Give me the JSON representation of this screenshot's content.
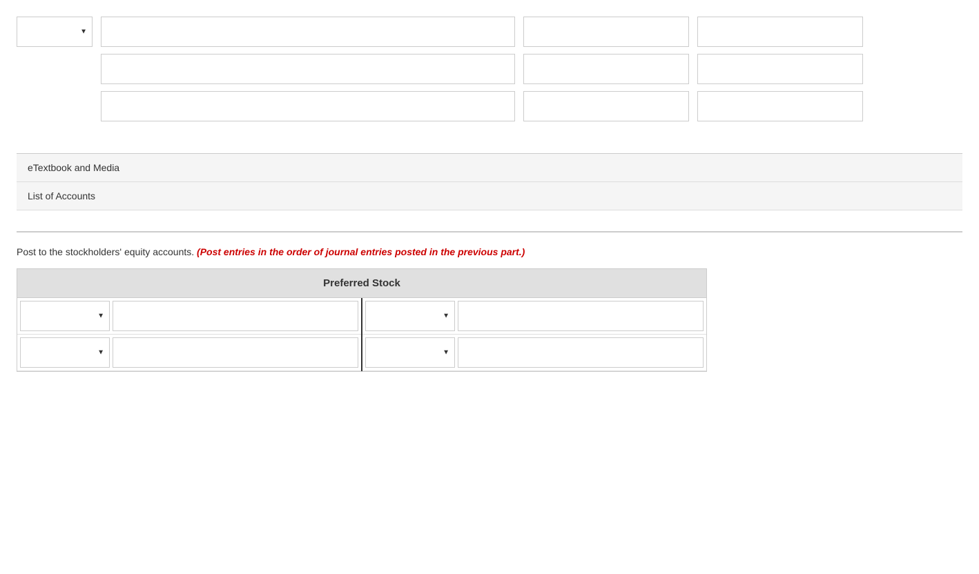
{
  "top_form": {
    "rows": [
      {
        "has_select": true,
        "select_placeholder": "",
        "inputs": [
          "",
          "",
          ""
        ]
      },
      {
        "has_select": false,
        "inputs": [
          "",
          "",
          ""
        ]
      },
      {
        "has_select": false,
        "inputs": [
          "",
          "",
          ""
        ]
      }
    ]
  },
  "links": [
    {
      "label": "eTextbook and Media"
    },
    {
      "label": "List of Accounts"
    }
  ],
  "instruction": {
    "text_before": "Post to the stockholders' equity accounts.",
    "text_highlight": " (Post entries in the order of journal entries posted in the previous part.)"
  },
  "ledger": {
    "title": "Preferred Stock",
    "left_rows": [
      {
        "select_val": "",
        "input_val": ""
      },
      {
        "select_val": "",
        "input_val": ""
      }
    ],
    "right_rows": [
      {
        "select_val": "",
        "input_val": ""
      },
      {
        "select_val": "",
        "input_val": ""
      }
    ]
  }
}
